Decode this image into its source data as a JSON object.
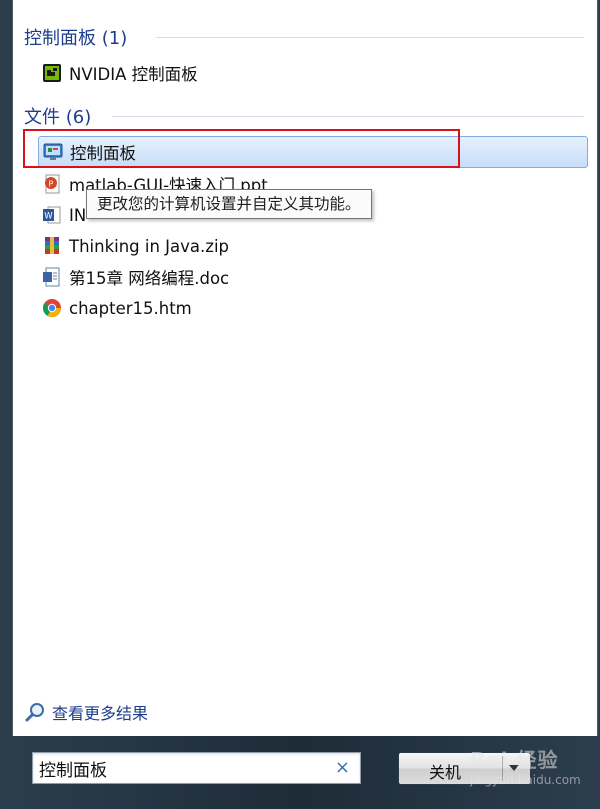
{
  "groups": {
    "control_panel": {
      "header": "控制面板 (1)"
    },
    "files": {
      "header": "文件 (6)"
    }
  },
  "items": {
    "nvidia": "NVIDIA 控制面板",
    "control_panel_file": "控制面板",
    "matlab": "matlab-GUI-快速入门.ppt",
    "word_doc": "IN",
    "thinking_java": "Thinking in Java.zip",
    "chapter_doc": "第15章 网络编程.doc",
    "chapter_htm": "chapter15.htm"
  },
  "tooltip": "更改您的计算机设置并自定义其功能。",
  "see_more": "查看更多结果",
  "search": {
    "value": "控制面板",
    "clear": "×"
  },
  "shutdown": {
    "label": "关机"
  },
  "watermark": {
    "main": "Bai 经验",
    "sub": "jingyan.baidu.com"
  },
  "colors": {
    "accent": "#1e3e8c",
    "highlight": "#d8121d",
    "selection": "#c6ddf7"
  }
}
